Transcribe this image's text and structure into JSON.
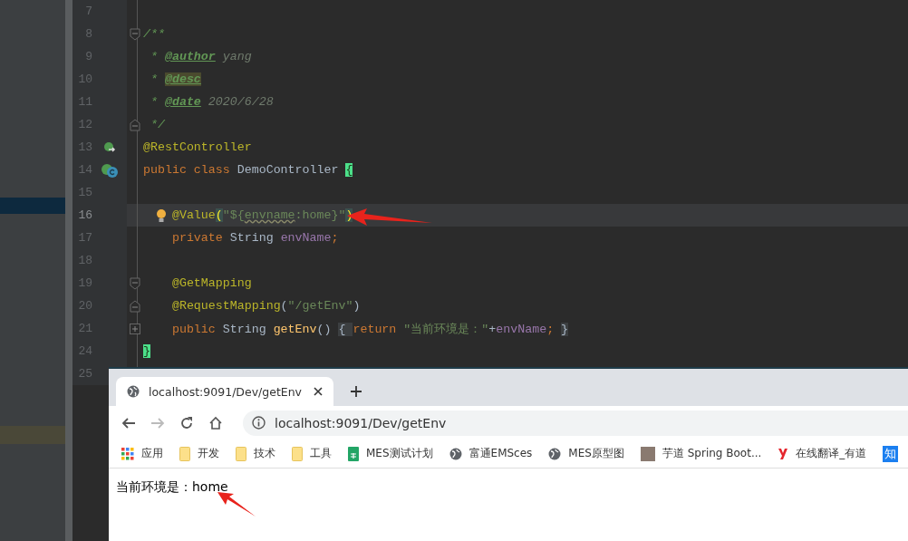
{
  "editor": {
    "lines": [
      {
        "number": "7",
        "current": false
      },
      {
        "number": "8",
        "current": false,
        "fold": {
          "kind": "start"
        },
        "tokens": [
          {
            "text": "/**",
            "kind": "comment"
          }
        ]
      },
      {
        "number": "9",
        "current": false,
        "tokens": [
          {
            "text": " * ",
            "kind": "comment"
          },
          {
            "text": "@author",
            "kind": "doctag"
          },
          {
            "text": " yang",
            "kind": "docvalue"
          }
        ]
      },
      {
        "number": "10",
        "current": false,
        "tokens": [
          {
            "text": " * ",
            "kind": "comment"
          },
          {
            "text": "@desc",
            "kind": "doctag-marked"
          }
        ]
      },
      {
        "number": "11",
        "current": false,
        "tokens": [
          {
            "text": " * ",
            "kind": "comment"
          },
          {
            "text": "@date",
            "kind": "doctag"
          },
          {
            "text": " 2020/6/28",
            "kind": "docvalue"
          }
        ]
      },
      {
        "number": "12",
        "current": false,
        "fold": {
          "kind": "end"
        },
        "tokens": [
          {
            "text": " */",
            "kind": "comment"
          }
        ]
      },
      {
        "number": "13",
        "current": false,
        "gutter_icon": {
          "kind": "bean-arrow"
        },
        "tokens": [
          {
            "text": "@RestController",
            "kind": "annotation"
          }
        ]
      },
      {
        "number": "14",
        "current": false,
        "gutter_icon": {
          "kind": "bean-class"
        },
        "tokens": [
          {
            "text": "public class ",
            "kind": "keyword"
          },
          {
            "text": "DemoController ",
            "kind": "plain"
          },
          {
            "text": "{",
            "kind": "match"
          }
        ]
      },
      {
        "number": "15",
        "current": false
      },
      {
        "number": "16",
        "current": true,
        "bulb": true,
        "tokens": [
          {
            "text": "    @Value",
            "kind": "annotation"
          },
          {
            "text": "(",
            "kind": "match-dim"
          },
          {
            "text": "\"${",
            "kind": "string"
          },
          {
            "text": "envname",
            "kind": "string-typo"
          },
          {
            "text": ":home}\"",
            "kind": "string"
          },
          {
            "text": ")",
            "kind": "match-dim"
          }
        ]
      },
      {
        "number": "17",
        "current": false,
        "tokens": [
          {
            "text": "    private ",
            "kind": "keyword"
          },
          {
            "text": "String ",
            "kind": "plain"
          },
          {
            "text": "envName",
            "kind": "field"
          },
          {
            "text": ";",
            "kind": "keyword"
          }
        ]
      },
      {
        "number": "18",
        "current": false
      },
      {
        "number": "19",
        "current": false,
        "fold": {
          "kind": "start"
        },
        "tokens": [
          {
            "text": "    @GetMapping",
            "kind": "annotation"
          }
        ]
      },
      {
        "number": "20",
        "current": false,
        "fold": {
          "kind": "end"
        },
        "tokens": [
          {
            "text": "    @RequestMapping",
            "kind": "annotation"
          },
          {
            "text": "(",
            "kind": "plain"
          },
          {
            "text": "\"/getEnv\"",
            "kind": "string"
          },
          {
            "text": ")",
            "kind": "plain"
          }
        ]
      },
      {
        "number": "21",
        "current": false,
        "fold": {
          "kind": "collapsed"
        },
        "tokens": [
          {
            "text": "    public ",
            "kind": "keyword"
          },
          {
            "text": "String ",
            "kind": "plain"
          },
          {
            "text": "getEnv",
            "kind": "method"
          },
          {
            "text": "() ",
            "kind": "plain"
          },
          {
            "text": "{ ",
            "kind": "folded"
          },
          {
            "text": "return ",
            "kind": "keyword"
          },
          {
            "text": "\"当前环境是：\"",
            "kind": "string"
          },
          {
            "text": "+",
            "kind": "plain"
          },
          {
            "text": "envName",
            "kind": "field"
          },
          {
            "text": "; ",
            "kind": "keyword"
          },
          {
            "text": "}",
            "kind": "folded"
          }
        ]
      },
      {
        "number": "24",
        "current": false,
        "tokens": [
          {
            "text": "}",
            "kind": "match"
          }
        ]
      },
      {
        "number": "25",
        "current": false
      }
    ]
  },
  "browser": {
    "tab": {
      "title": "localhost:9091/Dev/getEnv",
      "selected": true
    },
    "address": "localhost:9091/Dev/getEnv",
    "bookmarks": [
      {
        "label": "应用",
        "kind": "apps"
      },
      {
        "label": "开发",
        "kind": "folder"
      },
      {
        "label": "技术",
        "kind": "folder"
      },
      {
        "label": "工具",
        "kind": "folder"
      },
      {
        "label": "MES测试计划",
        "kind": "sheet"
      },
      {
        "label": "富通EMSces",
        "kind": "globe"
      },
      {
        "label": "MES原型图",
        "kind": "globe"
      },
      {
        "label": "芋道 Spring Boot...",
        "kind": "photo"
      },
      {
        "label": "在线翻译_有道",
        "kind": "logo"
      },
      {
        "label": "知",
        "kind": "text-badge"
      }
    ],
    "page_text": "当前环境是：home"
  }
}
